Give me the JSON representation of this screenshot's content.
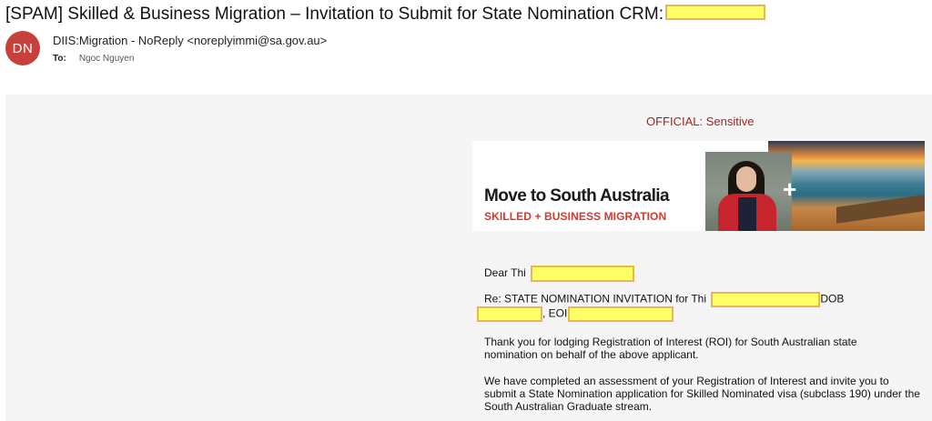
{
  "email": {
    "subject": "[SPAM] Skilled & Business Migration – Invitation to Submit for State Nomination CRM:",
    "avatar_initials": "DN",
    "sender": "DIIS:Migration - NoReply <noreplyimmi@sa.gov.au>",
    "to_label": "To:",
    "to_value": "Ngoc Nguyen"
  },
  "body": {
    "classification": "OFFICIAL: Sensitive",
    "banner": {
      "title": "Move to South Australia",
      "subtitle": "SKILLED + BUSINESS MIGRATION",
      "plus": "+"
    },
    "greeting": "Dear Thi",
    "re_prefix": "Re: STATE NOMINATION INVITATION for Thi",
    "re_dob": "DOB",
    "re_eoi": ", EOI",
    "paragraph_1": "Thank you for lodging Registration of Interest (ROI) for South Australian state nomination on behalf of the above applicant.",
    "paragraph_2": "We have completed an assessment of your Registration of Interest and invite you to submit a State Nomination application for Skilled Nominated visa (subclass 190) under the South Australian Graduate  stream."
  },
  "colors": {
    "avatar_bg": "#c8403b",
    "classification": "#a3241f",
    "brand_red": "#d13a2f",
    "redaction_fill": "#ffff66",
    "redaction_border": "#e8b84a"
  },
  "icons": [
    "person-photo",
    "beach-photo",
    "plus-icon"
  ]
}
